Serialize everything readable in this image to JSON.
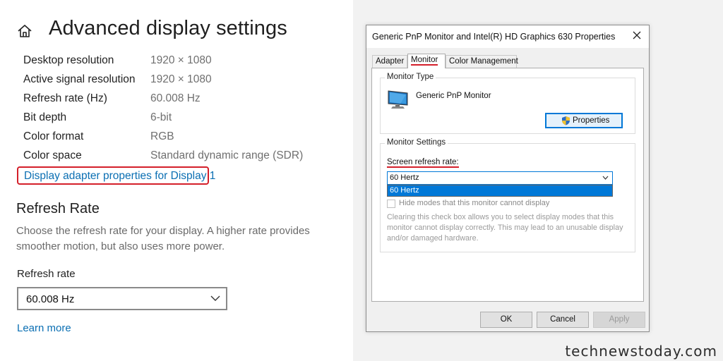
{
  "settings": {
    "title": "Advanced display settings",
    "info_rows": [
      {
        "label": "Desktop resolution",
        "value": "1920 × 1080"
      },
      {
        "label": "Active signal resolution",
        "value": "1920 × 1080"
      },
      {
        "label": "Refresh rate (Hz)",
        "value": "60.008 Hz"
      },
      {
        "label": "Bit depth",
        "value": "6-bit"
      },
      {
        "label": "Color format",
        "value": "RGB"
      },
      {
        "label": "Color space",
        "value": "Standard dynamic range (SDR)"
      }
    ],
    "adapter_link": "Display adapter properties for Display 1",
    "section_title": "Refresh Rate",
    "description": "Choose the refresh rate for your display. A higher rate provides smoother motion, but also uses more power.",
    "field_label": "Refresh rate",
    "selected_rate": "60.008 Hz",
    "learn_more": "Learn more"
  },
  "dialog": {
    "title": "Generic PnP Monitor and Intel(R) HD Graphics 630 Properties",
    "tabs": [
      "Adapter",
      "Monitor",
      "Color Management"
    ],
    "active_tab": "Monitor",
    "monitor_type": {
      "group_title": "Monitor Type",
      "name": "Generic PnP Monitor",
      "properties_button": "Properties"
    },
    "monitor_settings": {
      "group_title": "Monitor Settings",
      "refresh_label": "Screen refresh rate:",
      "selected": "60 Hertz",
      "dropdown_option": "60 Hertz",
      "hide_modes_label": "Hide modes that this monitor cannot display",
      "note": "Clearing this check box allows you to select display modes that this monitor cannot display correctly. This may lead to an unusable display and/or damaged hardware."
    },
    "buttons": {
      "ok": "OK",
      "cancel": "Cancel",
      "apply": "Apply"
    }
  },
  "watermark": "technewstoday.com",
  "colors": {
    "highlight": "#d41f2a",
    "link": "#0b6fb3",
    "accent": "#0078d7"
  }
}
